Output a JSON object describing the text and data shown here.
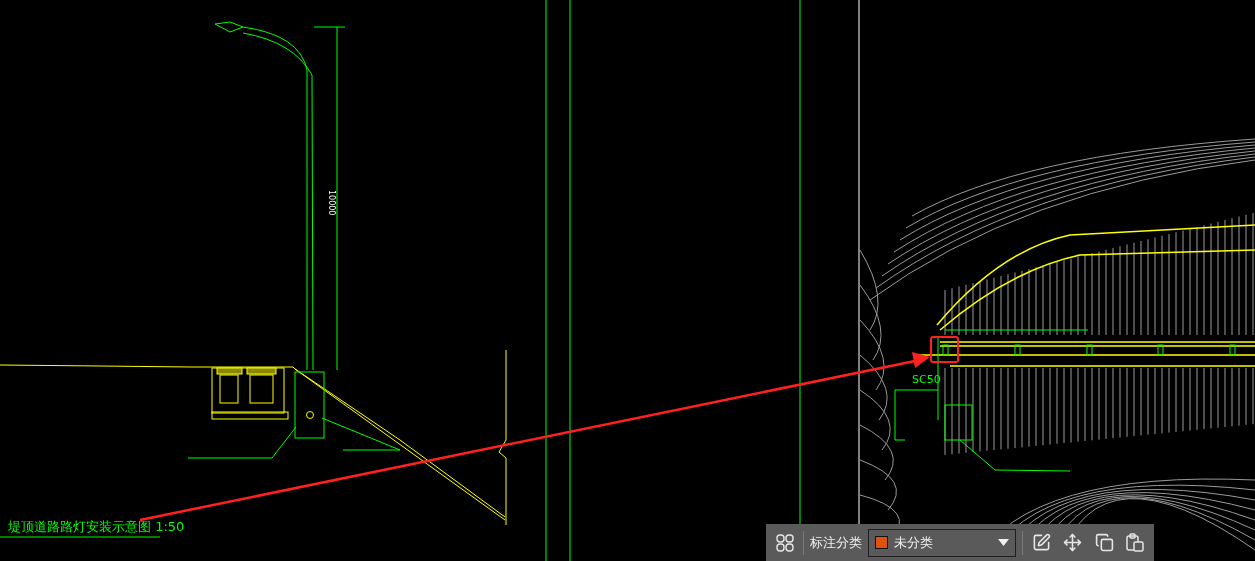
{
  "drawing": {
    "title": "堤顶道路路灯安装示意图 1:50",
    "dimension": "10000",
    "pipe_label": "SC50"
  },
  "toolbar": {
    "label": "标注分类",
    "category": {
      "value": "未分类",
      "color": "#e0520c"
    }
  }
}
